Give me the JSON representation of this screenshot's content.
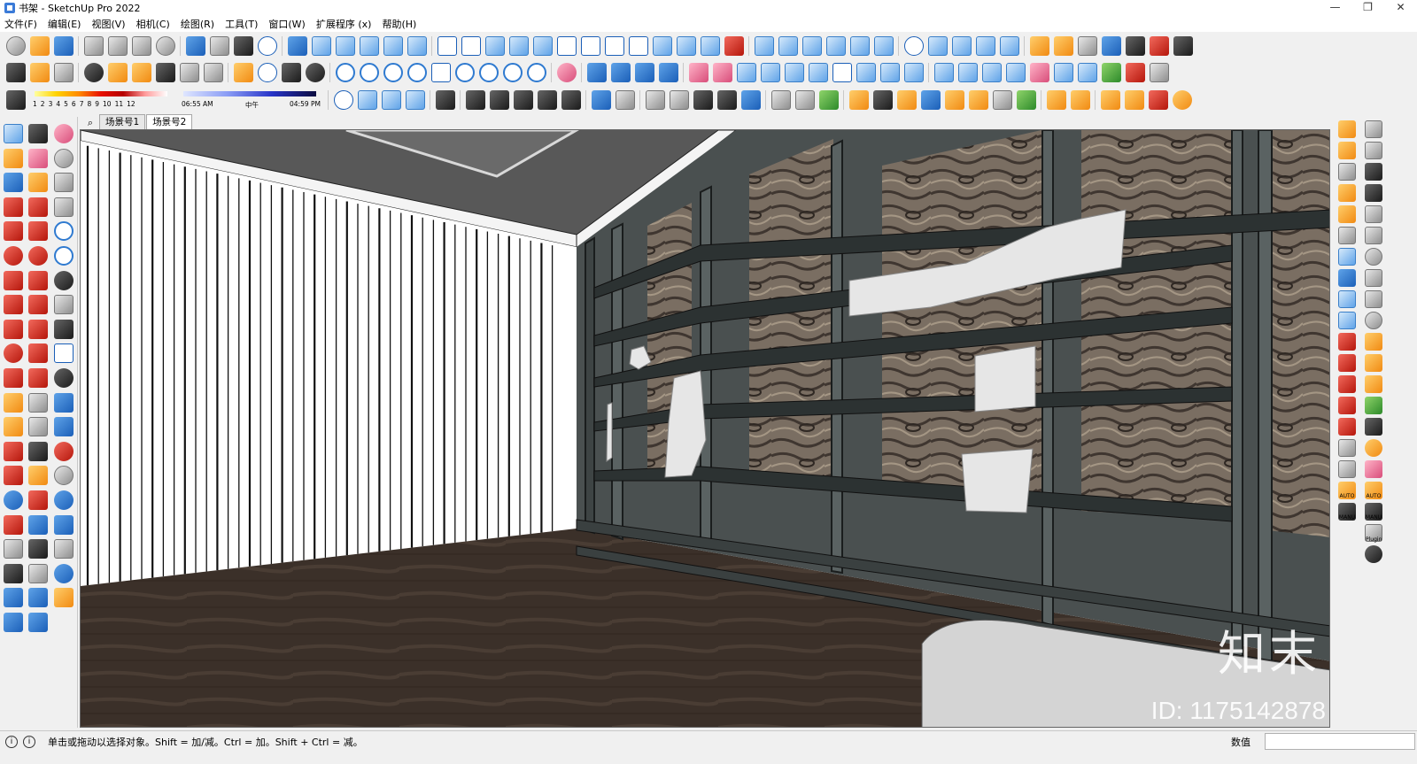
{
  "window": {
    "title": "书架 - SketchUp Pro 2022",
    "controls": [
      "—",
      "❐",
      "✕"
    ]
  },
  "menu": [
    "文件(F)",
    "编辑(E)",
    "视图(V)",
    "相机(C)",
    "绘图(R)",
    "工具(T)",
    "窗口(W)",
    "扩展程序 (x)",
    "帮助(H)"
  ],
  "shadow_toolbar": {
    "months": [
      "1",
      "2",
      "3",
      "4",
      "5",
      "6",
      "7",
      "8",
      "9",
      "10",
      "11",
      "12"
    ],
    "time_start": "06:55 AM",
    "time_mid": "中午",
    "time_end": "04:59 PM"
  },
  "scene_tabs": {
    "search_icon": "⌕",
    "tabs": [
      "场景号1",
      "场景号2"
    ],
    "active": "场景号2"
  },
  "right_labels": {
    "auto1": "AUTO",
    "manu1": "MANU",
    "auto2": "AUTO",
    "manu2": "MANU",
    "plugin": "Plugin"
  },
  "watermark": {
    "logo": "知末",
    "id": "ID: 1175142878"
  },
  "status": {
    "message": "单击或拖动以选择对象。Shift = 加/减。Ctrl = 加。Shift + Ctrl = 减。",
    "value_label": "数值",
    "value": ""
  },
  "colors": {
    "cabinet": "#4a5050",
    "floor": "#3b3029",
    "ceiling": "#585858",
    "wood_panel": "#7a6e62",
    "sculpture": "#e6e6e6"
  }
}
